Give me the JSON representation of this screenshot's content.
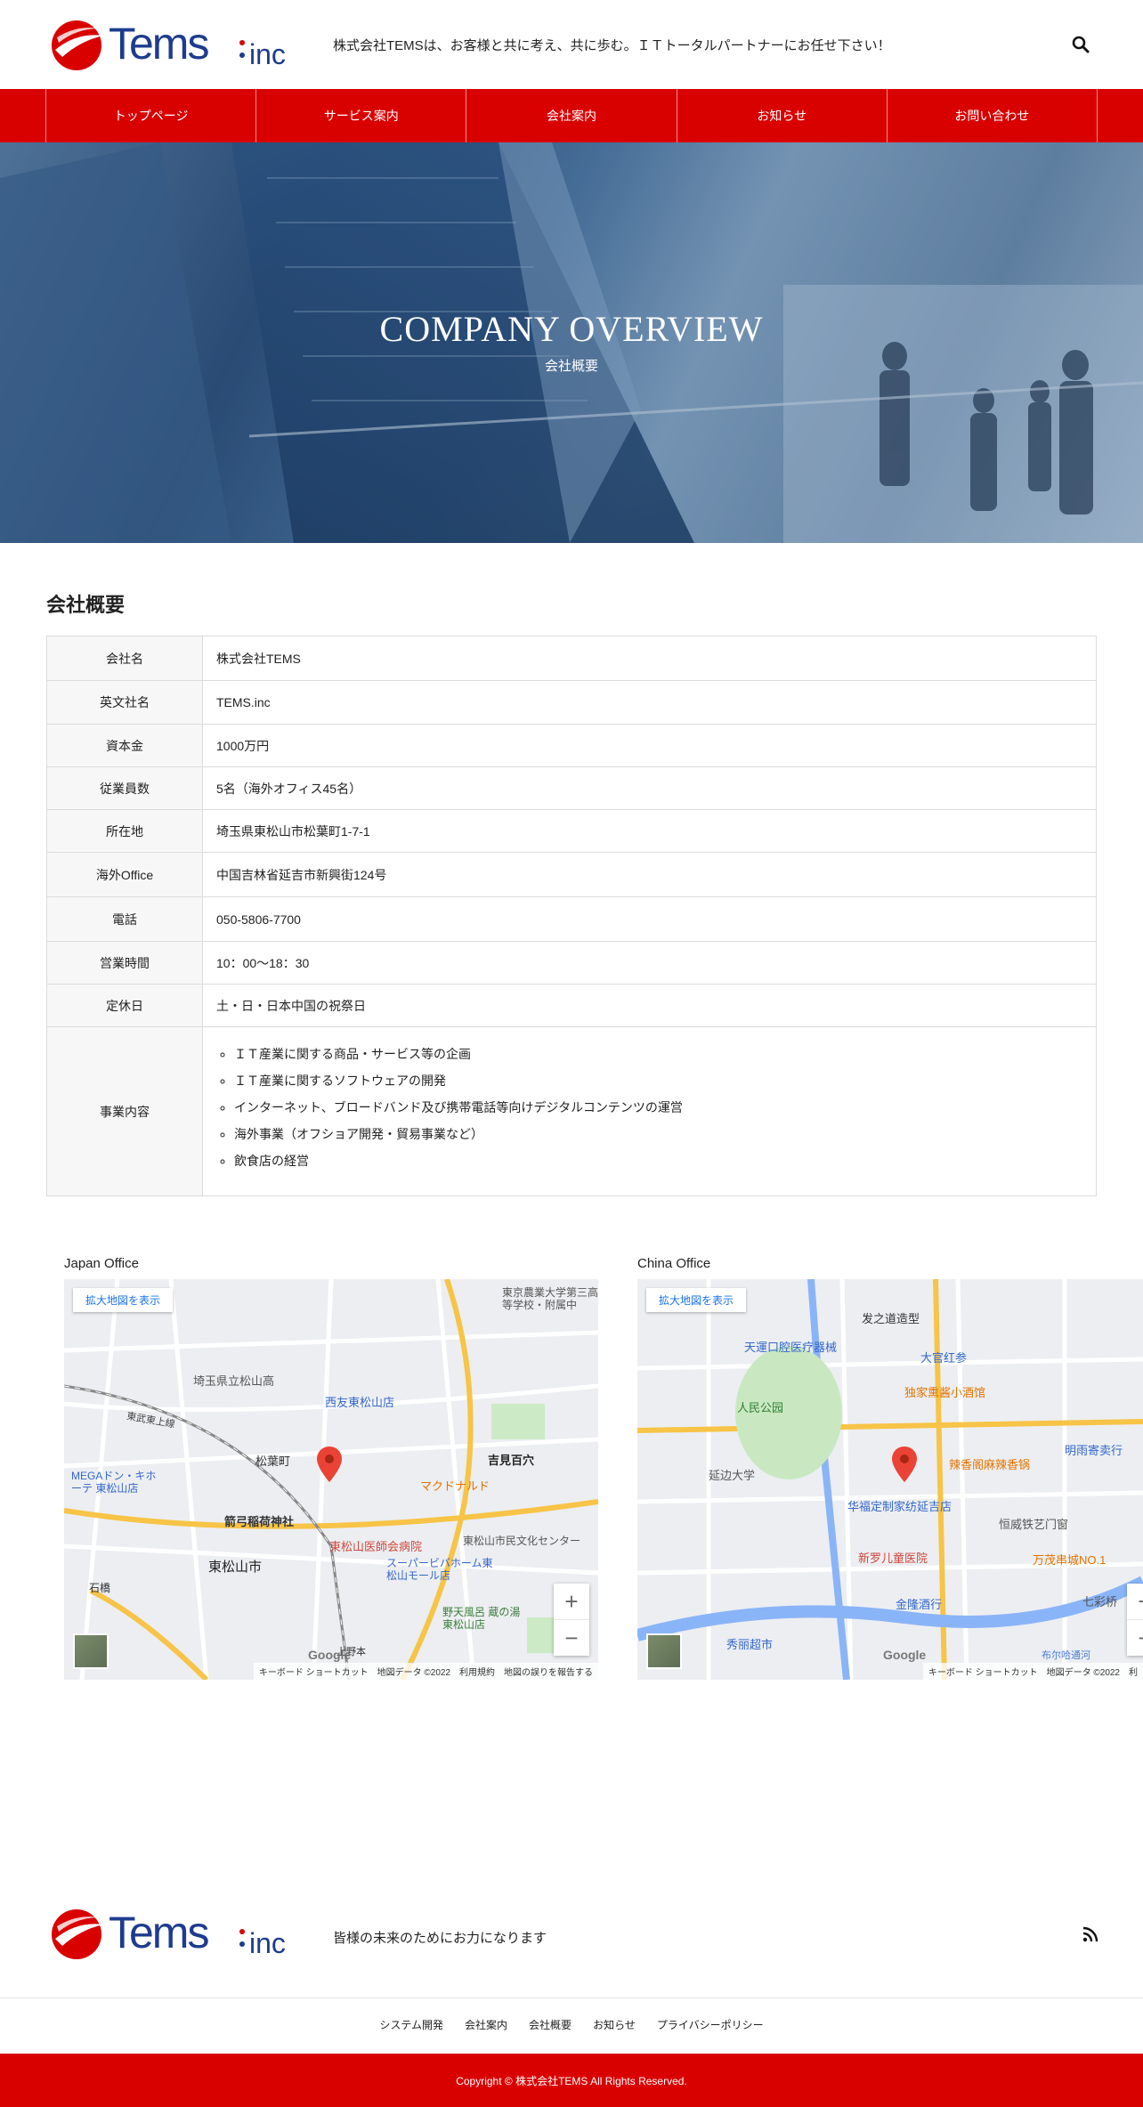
{
  "brand": {
    "logo_text": "Tems",
    "logo_suffix": "inc",
    "colors": {
      "primary": "#d90000",
      "logo_blue": "#1d3b8f",
      "link_blue": "#1a73e8"
    }
  },
  "header": {
    "tagline": "株式会社TEMSは、お客様と共に考え、共に歩む。ＩＴトータルパートナーにお任せ下さい！",
    "search_icon": "search-icon"
  },
  "nav": {
    "items": [
      {
        "label": "トップページ"
      },
      {
        "label": "サービス案内"
      },
      {
        "label": "会社案内"
      },
      {
        "label": "お知らせ"
      },
      {
        "label": "お問い合わせ"
      }
    ]
  },
  "hero": {
    "title": "COMPANY OVERVIEW",
    "subtitle": "会社概要"
  },
  "overview": {
    "heading": "会社概要",
    "rows": [
      {
        "label": "会社名",
        "value": "株式会社TEMS"
      },
      {
        "label": "英文社名",
        "value": "TEMS.inc"
      },
      {
        "label": "資本金",
        "value": "1000万円"
      },
      {
        "label": "従業員数",
        "value": "5名（海外オフィス45名）"
      },
      {
        "label": "所在地",
        "value": "埼玉県東松山市松葉町1-7-1"
      },
      {
        "label": "海外Office",
        "value": "中国吉林省延吉市新興街124号"
      },
      {
        "label": "電話",
        "value": "050-5806-7700"
      },
      {
        "label": "営業時間",
        "value": "10：00～18：30"
      },
      {
        "label": "定休日",
        "value": "土・日・日本中国の祝祭日"
      }
    ],
    "services_label": "事業内容",
    "services": [
      "ＩＴ産業に関する商品・サービス等の企画",
      "ＩＴ産業に関するソフトウェアの開発",
      "インターネット、ブロードバンド及び携帯電話等向けデジタルコンテンツの運営",
      "海外事業（オフショア開発・貿易事業など）",
      "飲食店の経営"
    ]
  },
  "maps": {
    "japan": {
      "label": "Japan Office",
      "link": "拡大地図を表示",
      "footer": "キーボード ショートカット　地図データ ©2022　利用規約　地図の誤りを報告する",
      "places": [
        "埼玉県立松山高",
        "西友東松山店",
        "松葉町",
        "箭弓稲荷神社",
        "東松山市",
        "東松山医師会病院",
        "スーパービバホーム東松山モール店",
        "吉見百穴",
        "マクドナルド",
        "東京農業大学第三高等学校・附属中",
        "MEGAドン・キホーテ 東松山店",
        "東松山市民文化センター",
        "野天風呂 蔵の湯 東松山店",
        "石橋",
        "上野本",
        "東武東上線"
      ]
    },
    "china": {
      "label": "China Office",
      "link": "拡大地図を表示",
      "footer": "キーボード ショートカット　地図データ ©2022　利",
      "places": [
        "天運口腔医疗器械",
        "发之道造型",
        "大官红参",
        "独家熏酱小酒馆",
        "人民公园",
        "延边大学",
        "辣香阁麻辣香锅",
        "华福定制家纺延吉店",
        "恒威铁艺门窗",
        "新罗儿童医院",
        "金隆酒行",
        "万茂串城NO.1",
        "秀丽超市",
        "明雨寄卖行",
        "七彩桥",
        "布尔哈通河"
      ]
    },
    "google_text": "Google"
  },
  "footer": {
    "tagline": "皆様の未来のためにお力になります",
    "links": [
      "システム開発",
      "会社案内",
      "会社概要",
      "お知らせ",
      "プライバシーポリシー"
    ],
    "copyright": "Copyright © 株式会社TEMS All Rights Reserved."
  }
}
